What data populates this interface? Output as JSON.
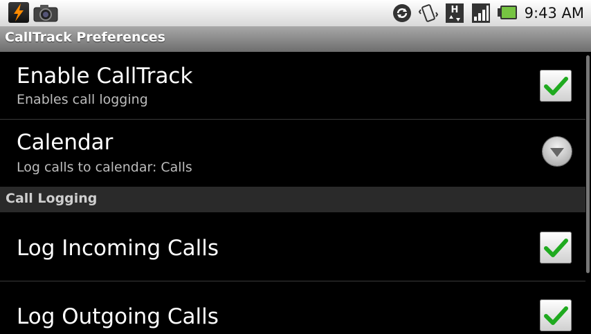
{
  "status_bar": {
    "time": "9:43 AM",
    "network_badge": "H",
    "left_icons": [
      "lightning-app-icon",
      "camera-icon"
    ],
    "right_icons": [
      "sync-icon",
      "vibrate-icon",
      "data-transfer-icon",
      "signal-icon",
      "battery-icon"
    ]
  },
  "titlebar": {
    "title": "CallTrack Preferences"
  },
  "prefs": {
    "enable": {
      "title": "Enable CallTrack",
      "summary": "Enables call logging",
      "checked": true
    },
    "calendar": {
      "title": "Calendar",
      "summary": "Log calls to calendar: Calls"
    },
    "category_call_logging": "Call Logging",
    "log_incoming": {
      "title": "Log Incoming Calls",
      "checked": true
    },
    "log_outgoing": {
      "title": "Log Outgoing Calls",
      "checked": true
    }
  },
  "colors": {
    "check_green": "#1faa1f",
    "background": "#000000",
    "summary_text": "#bdbdbd"
  }
}
